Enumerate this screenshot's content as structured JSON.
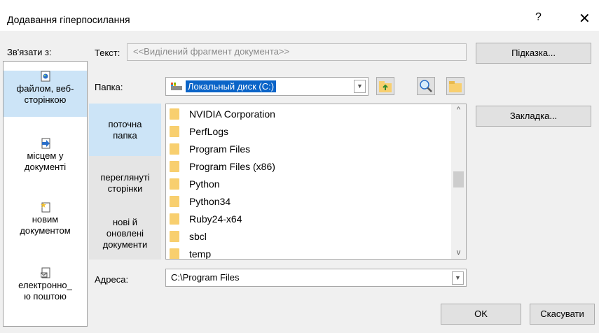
{
  "dialog": {
    "title": "Додавання гіперпосилання",
    "help": "?",
    "close": "✕"
  },
  "link_to": {
    "label": "Зв'язати з:",
    "items": [
      {
        "icon": "web-page-icon",
        "line1": "файлом, веб-",
        "line2": "сторінкою"
      },
      {
        "icon": "document-place-icon",
        "line1": "місцем у",
        "line2": "документі"
      },
      {
        "icon": "new-document-icon",
        "line1": "новим",
        "line2": "документом"
      },
      {
        "icon": "email-icon",
        "line1": "електронно_",
        "line2": "ю поштою"
      }
    ]
  },
  "text": {
    "label": "Текст:",
    "value": "<<Виділений фрагмент документа>>"
  },
  "buttons": {
    "tip": "Підказка...",
    "bookmark": "Закладка...",
    "ok": "OK",
    "cancel": "Скасувати"
  },
  "folder": {
    "label": "Папка:",
    "value": "Локальный диск (C:)",
    "tools": [
      "upload-folder-icon",
      "browse-web-icon",
      "browse-file-icon"
    ]
  },
  "look_in": {
    "items": [
      {
        "line1": "поточна",
        "line2": "папка"
      },
      {
        "line1": "переглянуті",
        "line2": "сторінки"
      },
      {
        "line1": "нові й",
        "line2": "оновлені",
        "line3": "документи"
      }
    ]
  },
  "files": [
    "NVIDIA Corporation",
    "PerfLogs",
    "Program Files",
    "Program Files (x86)",
    "Python",
    "Python34",
    "Ruby24-x64",
    "sbcl",
    "temp"
  ],
  "address": {
    "label": "Адреса:",
    "value": "C:\\Program Files"
  },
  "colors": {
    "selection": "#cce4f7",
    "folder_highlight": "#0a64c8",
    "folder_icon": "#f8cf6f"
  }
}
